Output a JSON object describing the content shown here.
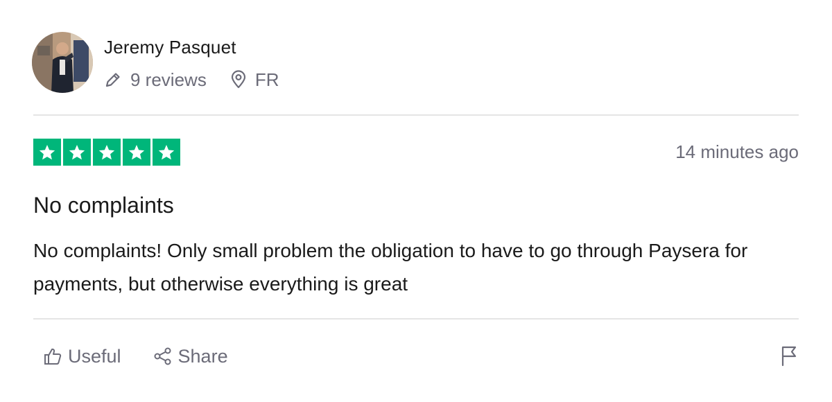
{
  "reviewer": {
    "name": "Jeremy Pasquet",
    "reviews_count": "9 reviews",
    "country": "FR",
    "avatar_icon": "profile-photo"
  },
  "review": {
    "rating": 5,
    "rating_max": 5,
    "star_color": "#00b67a",
    "timestamp": "14 minutes ago",
    "title": "No complaints",
    "body": "No complaints! Only small problem the obligation to have to go through Paysera for payments, but otherwise everything is great"
  },
  "actions": {
    "useful_label": "Useful",
    "share_label": "Share",
    "icons": [
      "thumbs-up-icon",
      "share-icon",
      "flag-icon"
    ]
  },
  "colors": {
    "text": "#1a1a1a",
    "muted": "#6b6b78",
    "divider": "#e5e5e5"
  }
}
